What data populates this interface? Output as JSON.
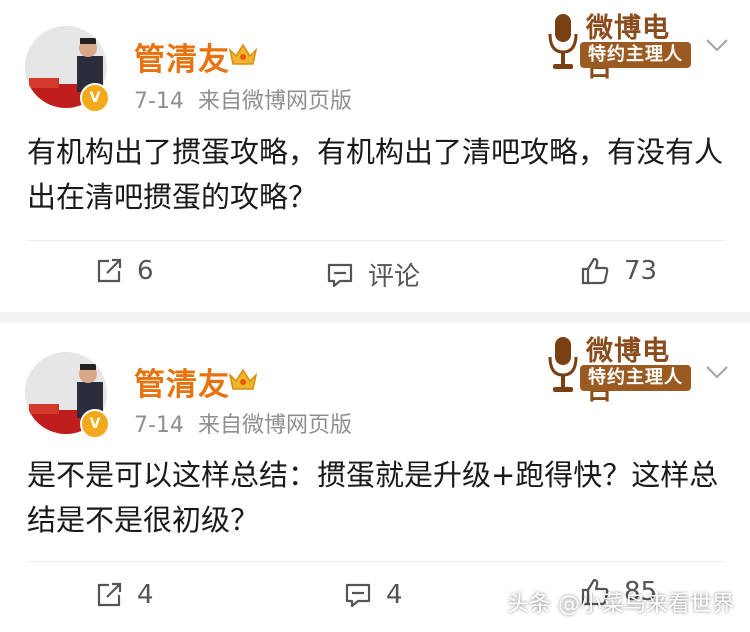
{
  "posts": [
    {
      "author": "管清友",
      "date": "7-14",
      "source": "来自微博网页版",
      "badge_title": "微博电台",
      "badge_sub": "特约主理人",
      "content": "有机构出了掼蛋攻略，有机构出了清吧攻略，有没有人出在清吧掼蛋的攻略？",
      "actions": {
        "repost": "6",
        "comment": "评论",
        "like": "73"
      }
    },
    {
      "author": "管清友",
      "date": "7-14",
      "source": "来自微博网页版",
      "badge_title": "微博电台",
      "badge_sub": "特约主理人",
      "content": "是不是可以这样总结：掼蛋就是升级+跑得快？这样总结是不是很初级？",
      "actions": {
        "repost": "4",
        "comment": "4",
        "like": "85"
      }
    }
  ],
  "watermark": "头条 @小菜鸟来看世界",
  "icons": {
    "repost": "repost-icon",
    "comment": "comment-icon",
    "like": "thumbs-up-icon",
    "more": "chevron-down-icon",
    "verified": "verified-badge-icon",
    "crown": "crown-icon"
  },
  "colors": {
    "author_name": "#e8730e",
    "meta_text": "#8f8f8f",
    "verified_badge": "#f3a91a",
    "radio_badge": "#9b5a22",
    "separator": "#f2f2f2"
  }
}
